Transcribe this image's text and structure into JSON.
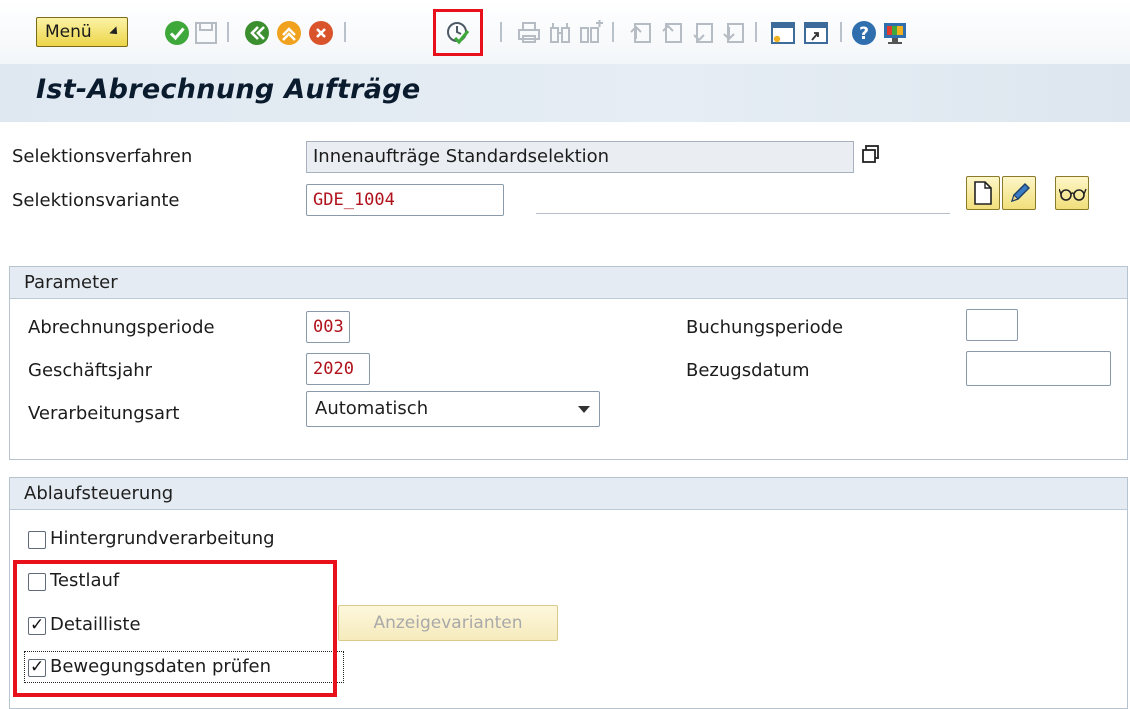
{
  "toolbar": {
    "menu_label": "Menü",
    "icons": [
      "enter-icon",
      "save-icon",
      "back-icon",
      "exit-icon",
      "cancel-icon",
      "execute-icon",
      "print-icon",
      "find-icon",
      "find-next-icon",
      "first-page-icon",
      "previous-page-icon",
      "next-page-icon",
      "last-page-icon",
      "create-session-icon",
      "shortcut-icon",
      "help-icon",
      "customize-layout-icon"
    ],
    "highlight_color": "#e8101a"
  },
  "page": {
    "title": "Ist-Abrechnung Aufträge"
  },
  "selection": {
    "procedure_label": "Selektionsverfahren",
    "procedure_value": "Innenaufträge Standardselektion",
    "variant_label": "Selektionsvariante",
    "variant_value": "GDE_1004"
  },
  "parameter": {
    "title": "Parameter",
    "period_label": "Abrechnungsperiode",
    "period_value": "003",
    "fiscal_year_label": "Geschäftsjahr",
    "fiscal_year_value": "2020",
    "processing_label": "Verarbeitungsart",
    "processing_value": "Automatisch",
    "posting_period_label": "Buchungsperiode",
    "posting_period_value": "",
    "reference_date_label": "Bezugsdatum",
    "reference_date_value": ""
  },
  "control": {
    "title": "Ablaufsteuerung",
    "background_label": "Hintergrundverarbeitung",
    "background_checked": false,
    "testrun_label": "Testlauf",
    "testrun_checked": false,
    "detaillist_label": "Detailliste",
    "detaillist_checked": true,
    "display_variants_label": "Anzeigevarianten",
    "movement_check_label": "Bewegungsdaten prüfen",
    "movement_check_checked": true
  },
  "colors": {
    "value_text": "#b0121b",
    "group_header": "#e4ebf2",
    "menu_button": "#ecd548"
  }
}
